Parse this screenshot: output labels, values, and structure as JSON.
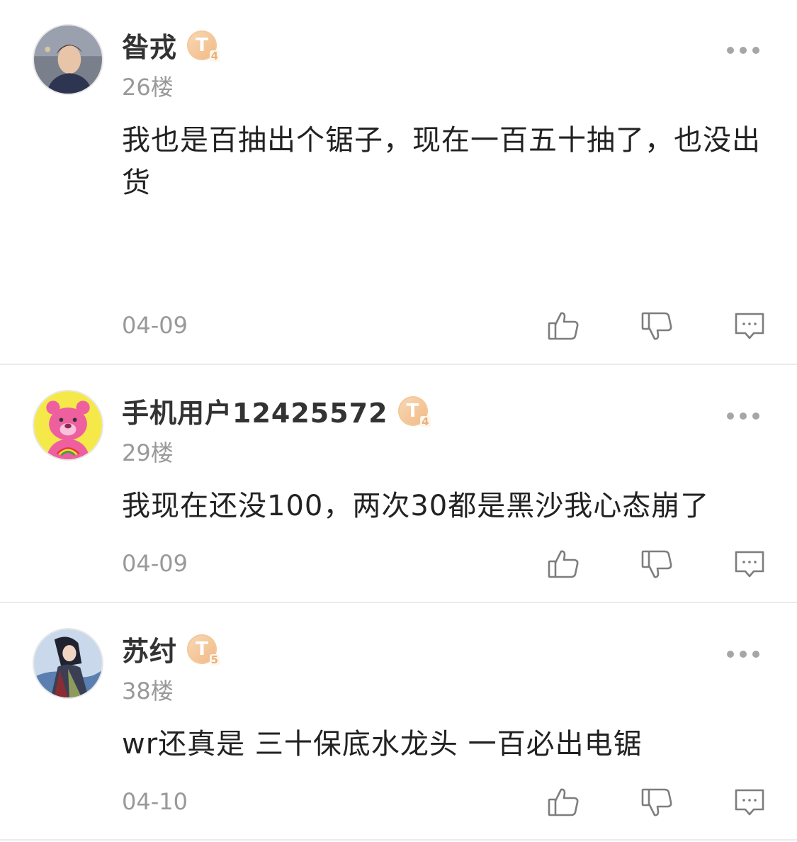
{
  "comments": [
    {
      "username": "昝戎",
      "level": "4",
      "floor": "26楼",
      "content": "我也是百抽出个锯子，现在一百五十抽了，也没出货",
      "date": "04-09"
    },
    {
      "username": "手机用户12425572",
      "level": "4",
      "floor": "29楼",
      "content": "我现在还没100，两次30都是黑沙我心态崩了",
      "date": "04-09"
    },
    {
      "username": "苏纣",
      "level": "5",
      "floor": "38楼",
      "content": "wr还真是 三十保底水龙头 一百必出电锯",
      "date": "04-10"
    }
  ],
  "icons": {
    "more": "more-dots-icon",
    "like": "thumbs-up-icon",
    "dislike": "thumbs-down-icon",
    "reply": "comment-bubble-icon",
    "level": "level-badge-icon"
  },
  "colors": {
    "badge": "#f2b884",
    "meta_text": "#999999",
    "divider": "#ebebeb"
  }
}
